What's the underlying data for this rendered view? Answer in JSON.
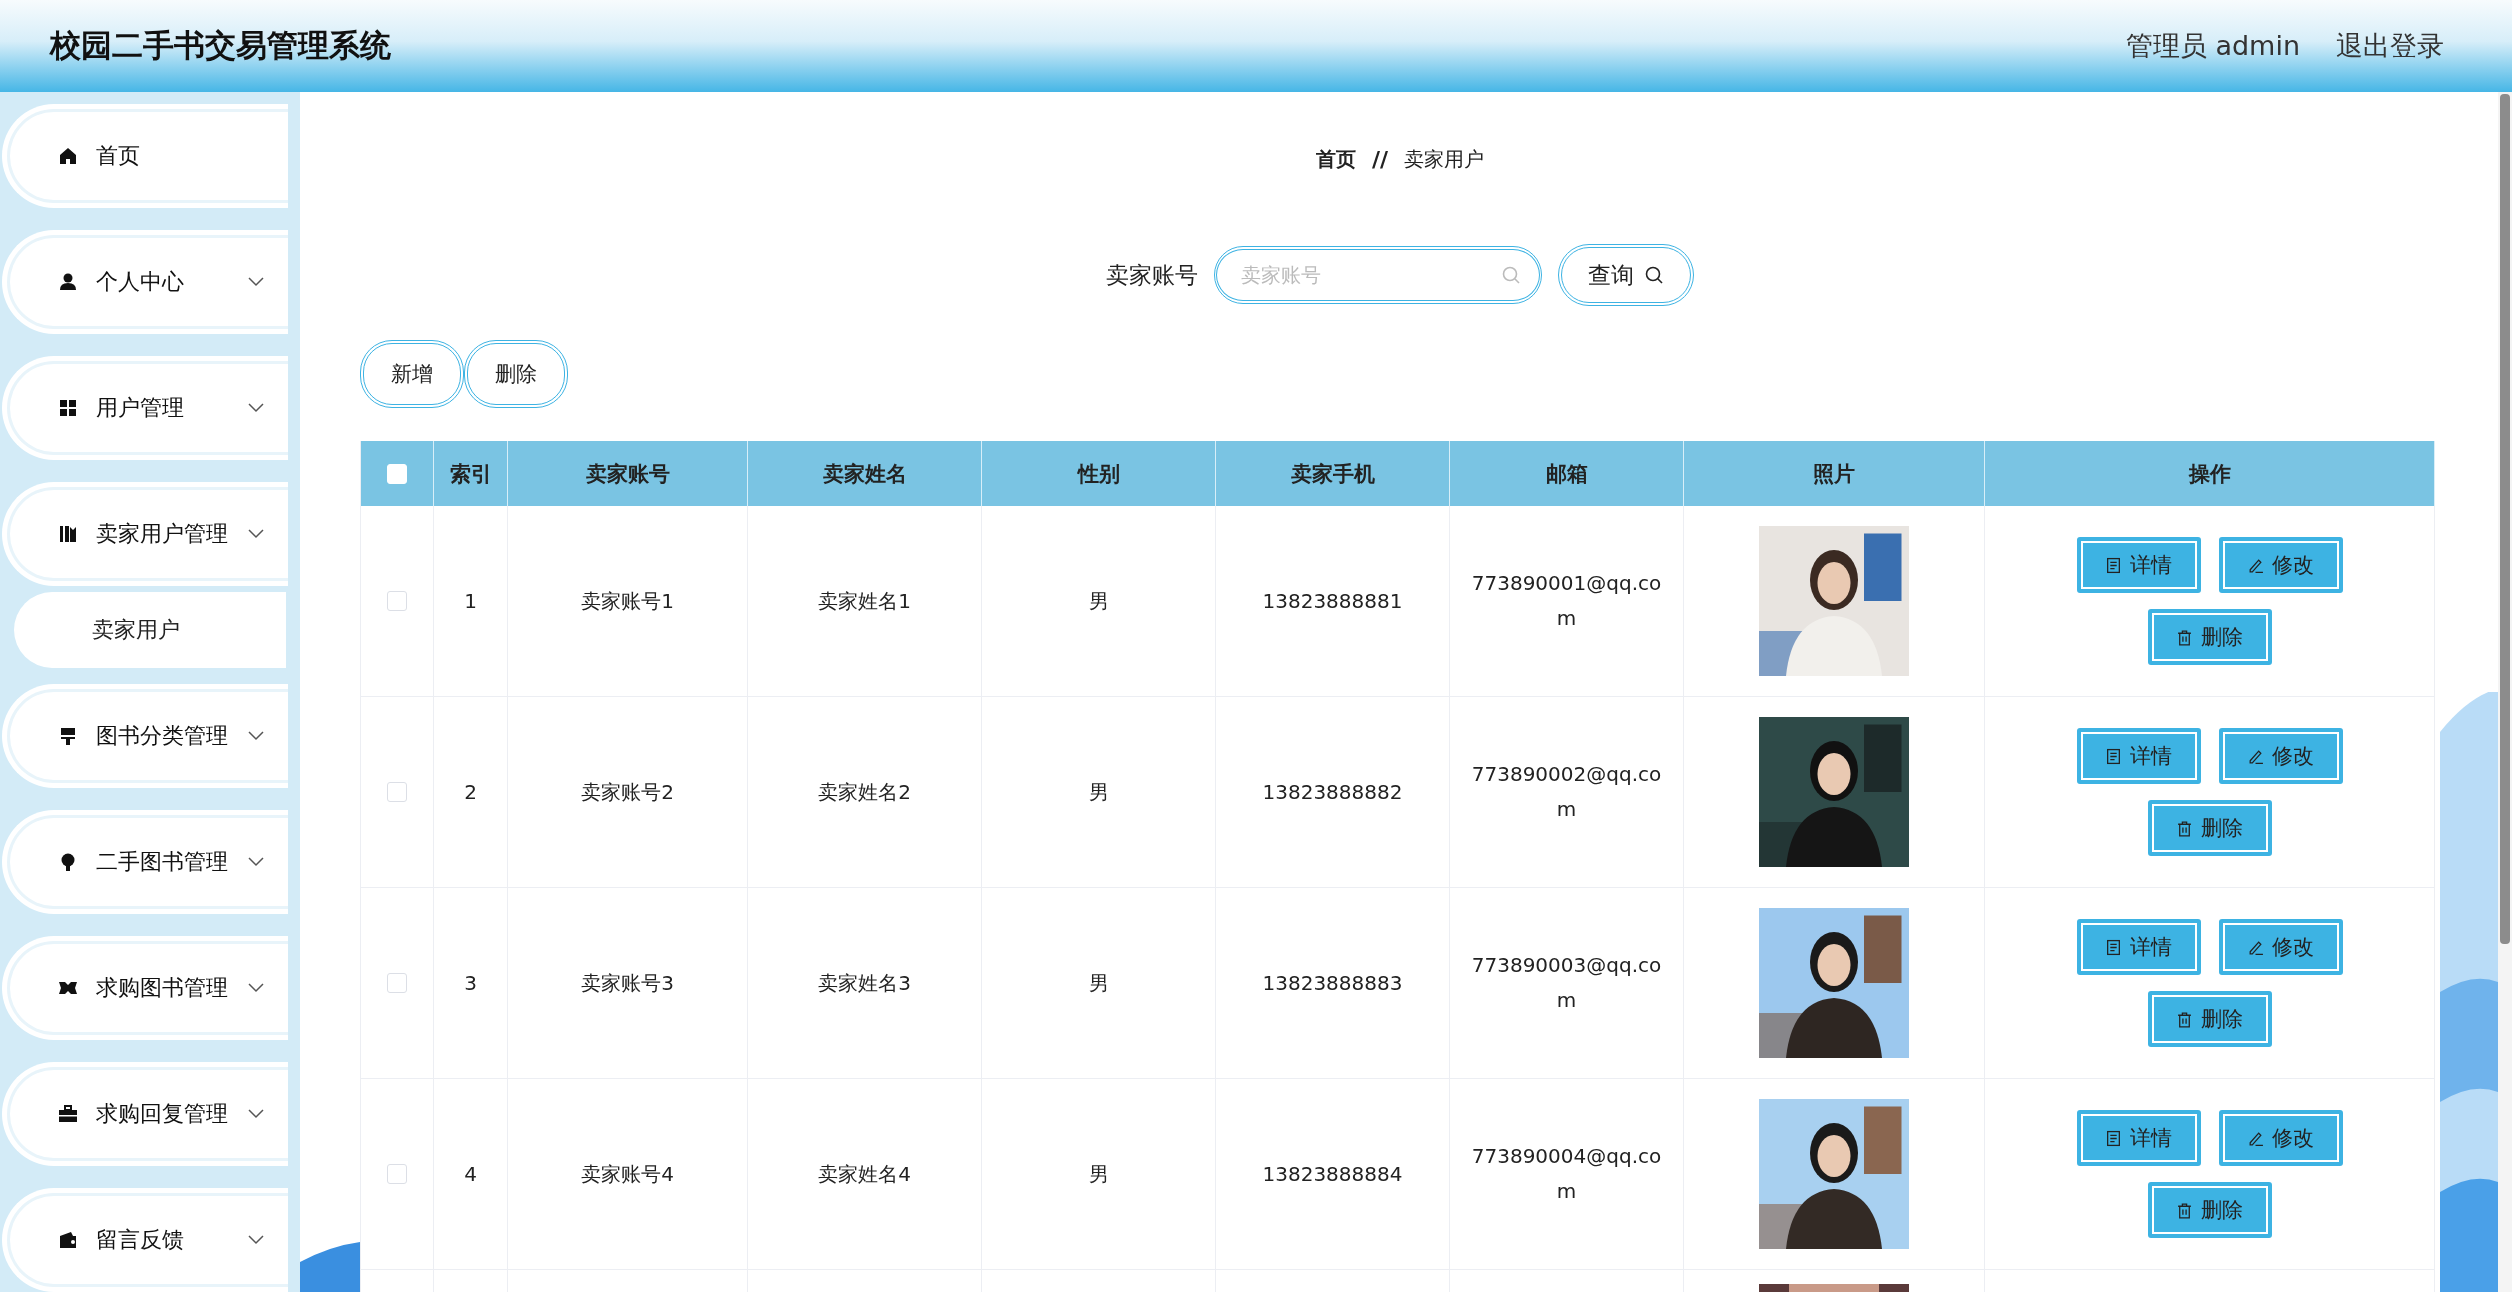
{
  "header": {
    "title": "校园二手书交易管理系统",
    "user": "管理员 admin",
    "logout": "退出登录"
  },
  "sidebar": {
    "items": [
      {
        "label": "首页",
        "kind": "link"
      },
      {
        "label": "个人中心",
        "kind": "submenu"
      },
      {
        "label": "用户管理",
        "kind": "submenu"
      },
      {
        "label": "卖家用户管理",
        "kind": "submenu",
        "children": [
          {
            "label": "卖家用户"
          }
        ]
      },
      {
        "label": "图书分类管理",
        "kind": "submenu"
      },
      {
        "label": "二手图书管理",
        "kind": "submenu"
      },
      {
        "label": "求购图书管理",
        "kind": "submenu"
      },
      {
        "label": "求购回复管理",
        "kind": "submenu"
      },
      {
        "label": "留言反馈",
        "kind": "submenu"
      }
    ]
  },
  "breadcrumb": {
    "items": [
      "首页",
      "卖家用户"
    ],
    "separator": "//"
  },
  "search": {
    "label": "卖家账号",
    "placeholder": "卖家账号",
    "button": "查询"
  },
  "actions": [
    "新增",
    "删除"
  ],
  "table": {
    "select_all_checked": false,
    "columns": [
      "索引",
      "卖家账号",
      "卖家姓名",
      "性别",
      "卖家手机",
      "邮箱",
      "照片",
      "操作"
    ],
    "rows": [
      {
        "checked": false,
        "index": "1",
        "account": "卖家账号1",
        "name": "卖家姓名1",
        "gender": "男",
        "phone": "13823888881",
        "email": "773890001@qq.com",
        "photo": {
          "kind": "picture"
        },
        "actions": [
          "详情",
          "修改",
          "删除"
        ]
      },
      {
        "checked": false,
        "index": "2",
        "account": "卖家账号2",
        "name": "卖家姓名2",
        "gender": "男",
        "phone": "13823888882",
        "email": "773890002@qq.com",
        "photo": {
          "kind": "picture"
        },
        "actions": [
          "详情",
          "修改",
          "删除"
        ]
      },
      {
        "checked": false,
        "index": "3",
        "account": "卖家账号3",
        "name": "卖家姓名3",
        "gender": "男",
        "phone": "13823888883",
        "email": "773890003@qq.com",
        "photo": {
          "kind": "picture"
        },
        "actions": [
          "详情",
          "修改",
          "删除"
        ]
      },
      {
        "checked": false,
        "index": "4",
        "account": "卖家账号4",
        "name": "卖家姓名4",
        "gender": "男",
        "phone": "13823888884",
        "email": "773890004@qq.com",
        "photo": {
          "kind": "picture"
        },
        "actions": [
          "详情",
          "修改",
          "删除"
        ]
      }
    ],
    "cut_row": {
      "photo": {
        "kind": "picture"
      }
    }
  }
}
